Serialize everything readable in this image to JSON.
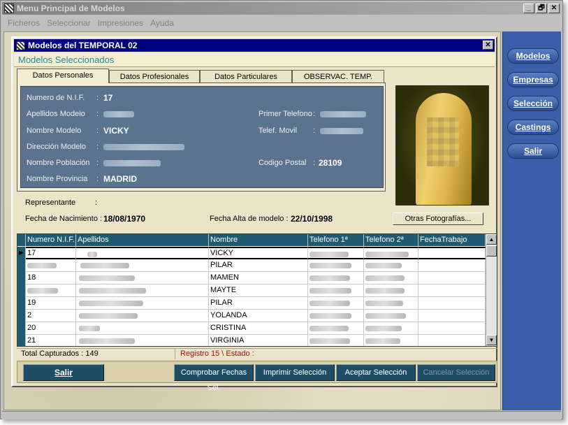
{
  "window": {
    "title": "Menu Principal de Modelos",
    "buttons": [
      "_",
      "🗗",
      "✕"
    ]
  },
  "menu": [
    "Ficheros",
    "Seleccionar",
    "Impresiones",
    "Ayuda"
  ],
  "side_nav": [
    "Modelos",
    "Empresas",
    "Selección",
    "Castings",
    "Salir"
  ],
  "child": {
    "title": "Modelos del TEMPORAL 02",
    "subheader": "Modelos Seleccionados",
    "tabs": [
      "Datos Personales",
      "Datos Profesionales",
      "Datos Particulares",
      "OBSERVAC. TEMP."
    ],
    "fields": {
      "nif_label": "Numero de N.I.F.",
      "nif_value": "17",
      "apellidos_label": "Apellidos Modelo",
      "nombre_label": "Nombre Modelo",
      "nombre_value": "VICKY",
      "direccion_label": "Dirección Modelo",
      "poblacion_label": "Nombre Población",
      "provincia_label": "Nombre Provincia",
      "provincia_value": "MADRID",
      "telefono1_label": "Primer Telefono",
      "movil_label": "Telef. Movil",
      "cp_label": "Codigo Postal",
      "cp_value": "28109",
      "colon": ":",
      "representante_label": "Representante",
      "nacimiento_label": "Fecha de Nacimiento :",
      "nacimiento_value": "18/08/1970",
      "alta_label": "Fecha Alta de modelo :",
      "alta_value": "22/10/1998"
    },
    "otras_fotos_button": "Otras Fotografías..."
  },
  "grid": {
    "columns": [
      "Numero N.I.F.",
      "Apellidos",
      "Nombre",
      "Telefono 1ª",
      "Telefono 2ª",
      "FechaTrabajo"
    ],
    "rows": [
      {
        "nif": "17",
        "nombre": "VICKY"
      },
      {
        "nif": "",
        "nombre": "PILAR"
      },
      {
        "nif": "18",
        "nombre": "MAMEN"
      },
      {
        "nif": "",
        "nombre": "MAYTE"
      },
      {
        "nif": "19",
        "nombre": "PILAR"
      },
      {
        "nif": "2",
        "nombre": "YOLANDA"
      },
      {
        "nif": "20",
        "nombre": "CRISTINA"
      },
      {
        "nif": "21",
        "nombre": "VIRGINIA"
      }
    ],
    "status_left": "Total Capturados : 149",
    "status_right": "Registro 15  \\  Estado :"
  },
  "bottom_buttons": {
    "salir": "Salir",
    "comprobar": "Comprobar Fechas Sel.",
    "imprimir": "Imprimir Selección",
    "aceptar": "Aceptar Selección",
    "cancelar": "Cancelar Selección"
  }
}
